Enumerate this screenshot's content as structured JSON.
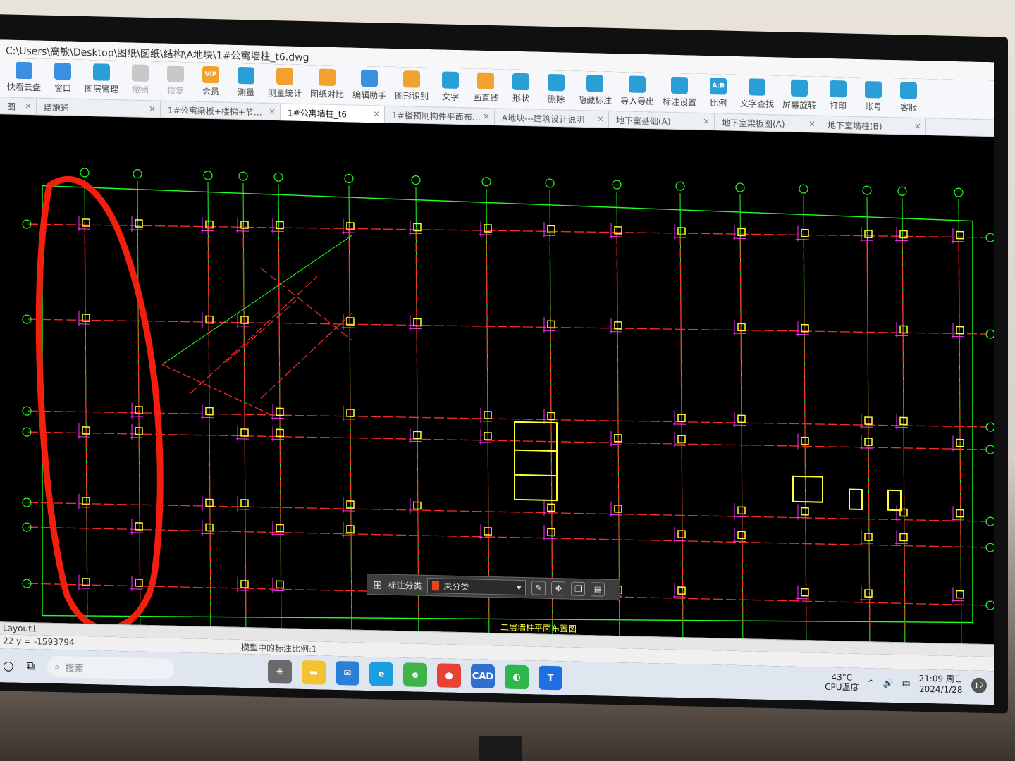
{
  "window": {
    "title": "C:\\Users\\高敏\\Desktop\\图纸\\图纸\\结构\\A地块\\1#公寓墙柱_t6.dwg"
  },
  "toolbar": {
    "items": [
      {
        "label": "快看云盘",
        "icon": "cloud-icon",
        "enabled": true
      },
      {
        "label": "窗口",
        "icon": "window-icon",
        "enabled": true
      },
      {
        "label": "图层管理",
        "icon": "layers-icon",
        "enabled": true
      },
      {
        "label": "撤销",
        "icon": "undo-icon",
        "enabled": false
      },
      {
        "label": "恢复",
        "icon": "redo-icon",
        "enabled": false
      },
      {
        "label": "会员",
        "icon": "vip-icon",
        "enabled": true,
        "badge": "VIP"
      },
      {
        "label": "测量",
        "icon": "measure-icon",
        "enabled": true
      },
      {
        "label": "测量统计",
        "icon": "measure-stats-icon",
        "enabled": true
      },
      {
        "label": "图纸对比",
        "icon": "compare-icon",
        "enabled": true
      },
      {
        "label": "编辑助手",
        "icon": "edit-assistant-icon",
        "enabled": true
      },
      {
        "label": "图形识别",
        "icon": "shape-recognize-icon",
        "enabled": true
      },
      {
        "label": "文字",
        "icon": "text-icon",
        "enabled": true
      },
      {
        "label": "画直线",
        "icon": "line-icon",
        "enabled": true
      },
      {
        "label": "形状",
        "icon": "shape-icon",
        "enabled": true
      },
      {
        "label": "删除",
        "icon": "eraser-icon",
        "enabled": true
      },
      {
        "label": "隐藏标注",
        "icon": "hide-annotation-icon",
        "enabled": true
      },
      {
        "label": "导入导出",
        "icon": "import-export-icon",
        "enabled": true
      },
      {
        "label": "标注设置",
        "icon": "annotation-settings-icon",
        "enabled": true
      },
      {
        "label": "比例",
        "icon": "scale-icon",
        "enabled": true,
        "badge": "A:B"
      },
      {
        "label": "文字查找",
        "icon": "text-search-icon",
        "enabled": true
      },
      {
        "label": "屏幕旋转",
        "icon": "rotate-screen-icon",
        "enabled": true
      },
      {
        "label": "打印",
        "icon": "print-icon",
        "enabled": true
      },
      {
        "label": "账号",
        "icon": "account-icon",
        "enabled": true
      },
      {
        "label": "客服",
        "icon": "headset-icon",
        "enabled": true
      }
    ]
  },
  "tabs": [
    {
      "label": "图",
      "active": false
    },
    {
      "label": "结施通",
      "active": false
    },
    {
      "label": "1#公寓梁板+楼梯+节…",
      "active": false
    },
    {
      "label": "1#公寓墙柱_t6",
      "active": true
    },
    {
      "label": "1#楼预制构件平面布…",
      "active": false
    },
    {
      "label": "A地块---建筑设计说明",
      "active": false
    },
    {
      "label": "地下室基础(A)",
      "active": false
    },
    {
      "label": "地下室梁板图(A)",
      "active": false
    },
    {
      "label": "地下室墙柱(B)",
      "active": false
    }
  ],
  "tab_close_glyph": "×",
  "drawing": {
    "caption": "二层墙柱平面布置图",
    "colors": {
      "grid_line": "#ff2a2a",
      "axis_line": "#22ff22",
      "column": "#ffff33",
      "dimension": "#ff33ff",
      "markup": "#ff2010"
    }
  },
  "annotation_bar": {
    "label": "标注分类",
    "category_value": "未分类",
    "swatch_color": "#e8431c"
  },
  "layout_tab": {
    "label": "Layout1"
  },
  "status": {
    "coords": "22  y = -1593794",
    "scale_text": "模型中的标注比例:1"
  },
  "taskbar": {
    "search_placeholder": "搜索",
    "apps": [
      "file-explorer-icon",
      "mail-icon",
      "edge-icon",
      "browser-360-icon",
      "chrome-icon",
      "cad-app-icon",
      "wechat-icon",
      "tencent-meeting-icon"
    ],
    "cad_app_label": "CAD",
    "temperature": "43°C",
    "temperature_label": "CPU温度",
    "ime": "中",
    "time": "21:09 周日",
    "date": "2024/1/28",
    "notification_count": "12"
  }
}
